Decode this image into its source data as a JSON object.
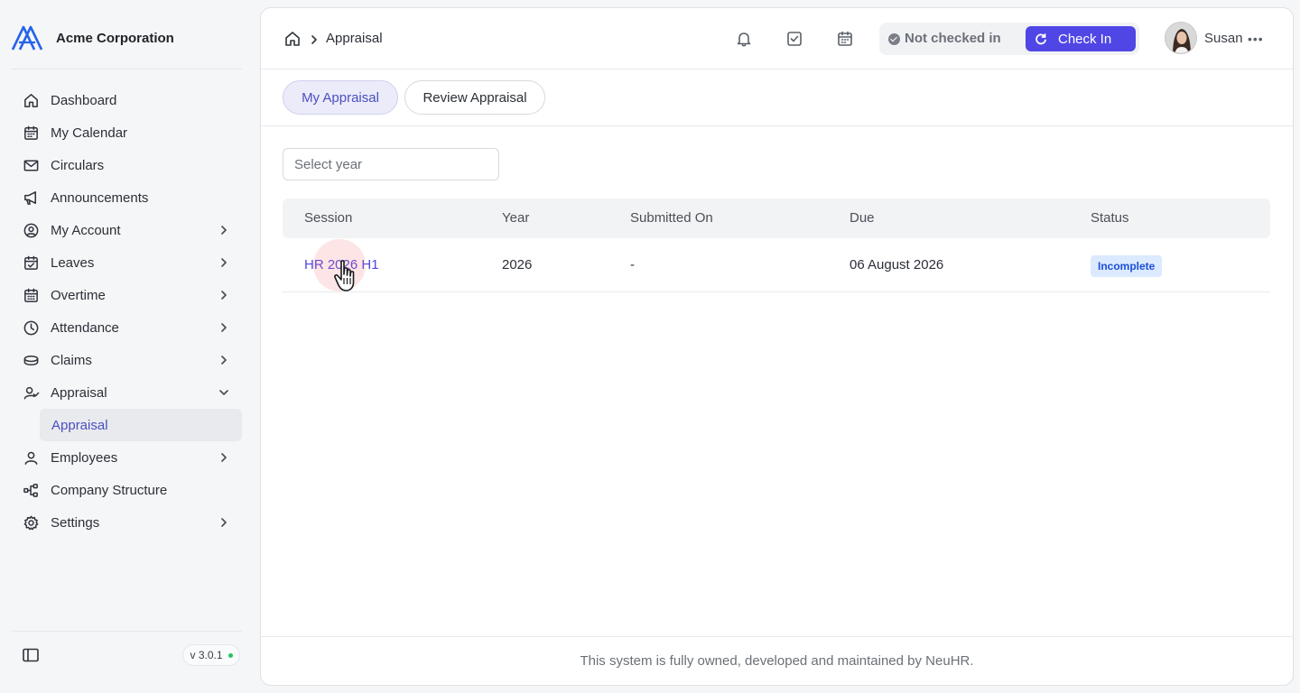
{
  "brand": {
    "name": "Acme Corporation"
  },
  "sidebar": {
    "items": [
      {
        "label": "Dashboard",
        "icon": "home-icon"
      },
      {
        "label": "My Calendar",
        "icon": "calendar-icon"
      },
      {
        "label": "Circulars",
        "icon": "mail-icon"
      },
      {
        "label": "Announcements",
        "icon": "megaphone-icon"
      },
      {
        "label": "My Account",
        "icon": "user-circle-icon"
      },
      {
        "label": "Leaves",
        "icon": "calendar-check-icon"
      },
      {
        "label": "Overtime",
        "icon": "calendar-clock-icon"
      },
      {
        "label": "Attendance",
        "icon": "clock-icon"
      },
      {
        "label": "Claims",
        "icon": "coins-icon"
      },
      {
        "label": "Appraisal",
        "icon": "user-check-icon"
      },
      {
        "label": "Employees",
        "icon": "user-icon"
      },
      {
        "label": "Company Structure",
        "icon": "org-chart-icon"
      },
      {
        "label": "Settings",
        "icon": "gear-icon"
      }
    ],
    "sub_item": "Appraisal",
    "version": "v 3.0.1"
  },
  "header": {
    "breadcrumb": "Appraisal",
    "status_text": "Not checked in",
    "checkin_label": "Check In",
    "user_name": "Susan"
  },
  "tabs": [
    "My Appraisal",
    "Review Appraisal"
  ],
  "filter": {
    "placeholder": "Select year"
  },
  "table": {
    "columns": [
      "Session",
      "Year",
      "Submitted On",
      "Due",
      "Status"
    ],
    "rows": [
      {
        "session": "HR 2026 H1",
        "year": "2026",
        "submitted_on": "-",
        "due": "06 August 2026",
        "status": "Incomplete"
      }
    ]
  },
  "footer": {
    "text": "This system is fully owned, developed and maintained by NeuHR."
  },
  "colors": {
    "accent": "#4f46e5",
    "badge_bg": "#dbeafe",
    "badge_text": "#1d4ed8"
  }
}
